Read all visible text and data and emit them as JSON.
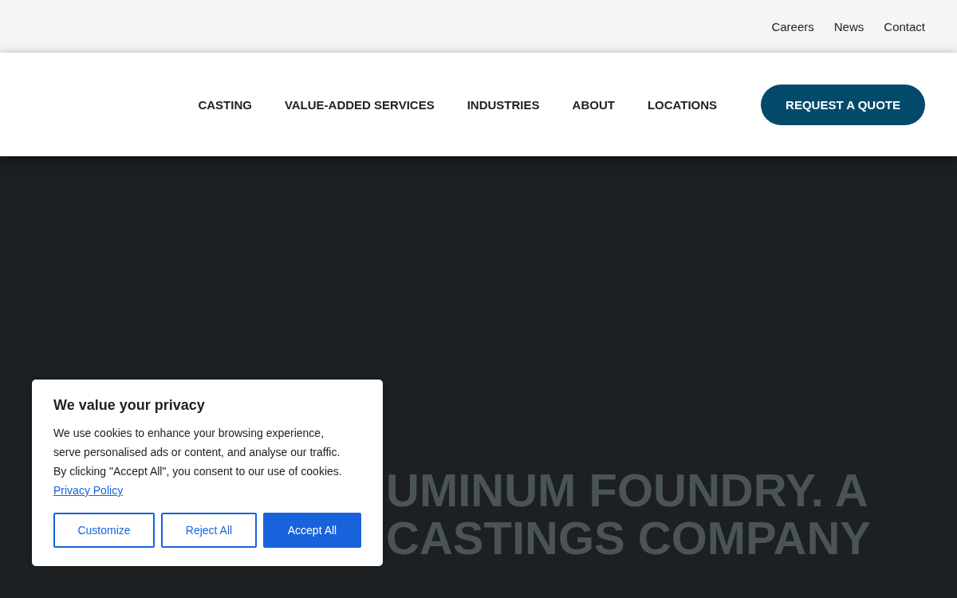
{
  "top_links": [
    "Careers",
    "News",
    "Contact"
  ],
  "nav": {
    "items": [
      "CASTING",
      "VALUE-ADDED SERVICES",
      "INDUSTRIES",
      "ABOUT",
      "LOCATIONS"
    ],
    "cta": "REQUEST A QUOTE"
  },
  "hero": {
    "heading_lines": [
      "UMINUM FOUNDRY. A",
      "CASTINGS COMPANY"
    ]
  },
  "cookie_banner": {
    "title": "We value your privacy",
    "text": "We use cookies to enhance your browsing experience, serve personalised ads or content, and analyse our traffic. By clicking \"Accept All\", you consent to our use of cookies.",
    "link": "Privacy Policy",
    "buttons": [
      {
        "label": "Customize",
        "kind": "outline"
      },
      {
        "label": "Reject All",
        "kind": "outline"
      },
      {
        "label": "Accept All",
        "kind": "primary"
      }
    ]
  }
}
